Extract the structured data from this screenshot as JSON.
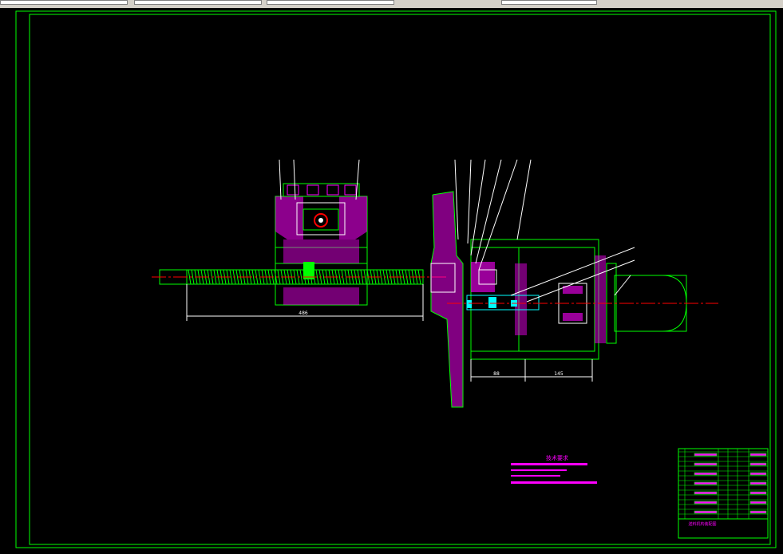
{
  "window": {
    "tabs": [
      "",
      "",
      "",
      ""
    ]
  },
  "drawing": {
    "dimension_left": "486",
    "dimension_mid": "88",
    "dimension_right": "145",
    "notes_title": "技术要求",
    "notes_lines": [
      "1.",
      "2.",
      "3."
    ],
    "title_block": {
      "drawing_title": "送料机构装配图",
      "scale_label": "比例",
      "school": "",
      "sheet": ""
    }
  },
  "colors": {
    "frame": "#00ff00",
    "section": "#ff00ff",
    "leader": "#ffffff",
    "centerline": "#ff0000",
    "thread": "#00ff00",
    "cyan": "#00ffff"
  }
}
